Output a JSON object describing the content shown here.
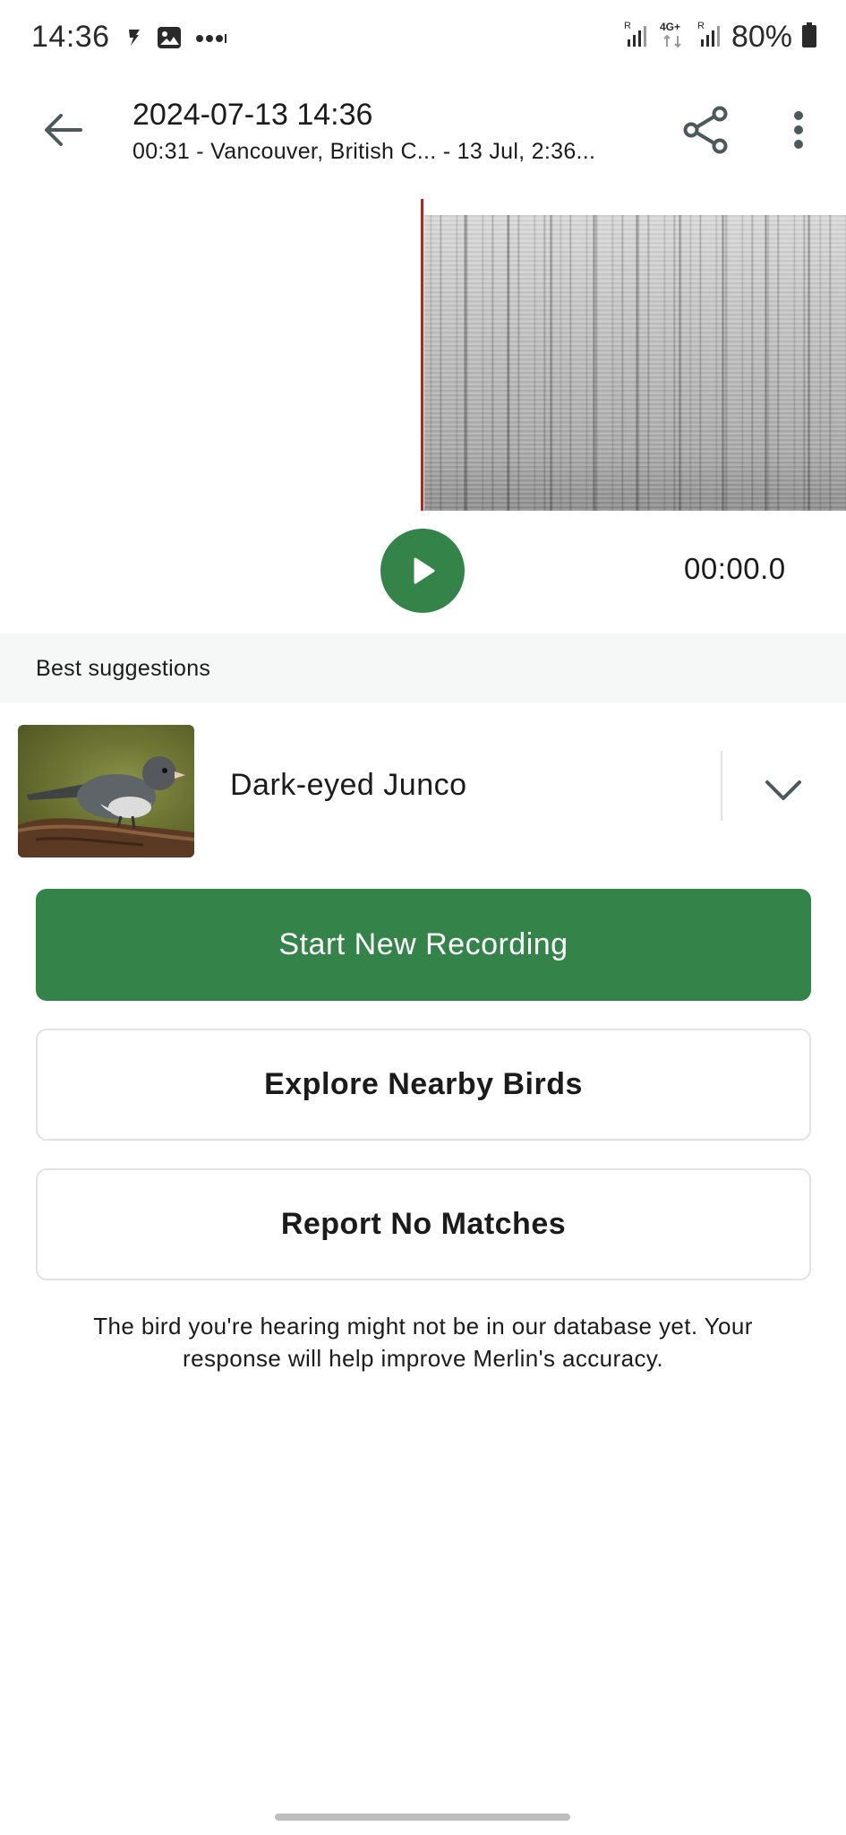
{
  "status_bar": {
    "time": "14:36",
    "battery": "80%",
    "network_label": "4G+",
    "icons": [
      "tiktok-icon",
      "gallery-icon",
      "more-dots-icon",
      "signal-icon",
      "battery-icon"
    ]
  },
  "app_bar": {
    "title": "2024-07-13 14:36",
    "subtitle": "00:31 - Vancouver, British C... - 13 Jul, 2:36..."
  },
  "player": {
    "time": "00:00.0"
  },
  "suggestions": {
    "header": "Best suggestions",
    "items": [
      {
        "name": "Dark-eyed Junco"
      }
    ]
  },
  "actions": {
    "start_recording": "Start New Recording",
    "explore_nearby": "Explore Nearby Birds",
    "report_no_matches": "Report No Matches"
  },
  "info_text": "The bird you're hearing might not be in our database yet. Your response will help improve Merlin's accuracy.",
  "colors": {
    "primary_green": "#34844a",
    "playhead_red": "#b3261e",
    "header_bg": "#f6f7f7",
    "outline_border": "#dfe3e4"
  }
}
